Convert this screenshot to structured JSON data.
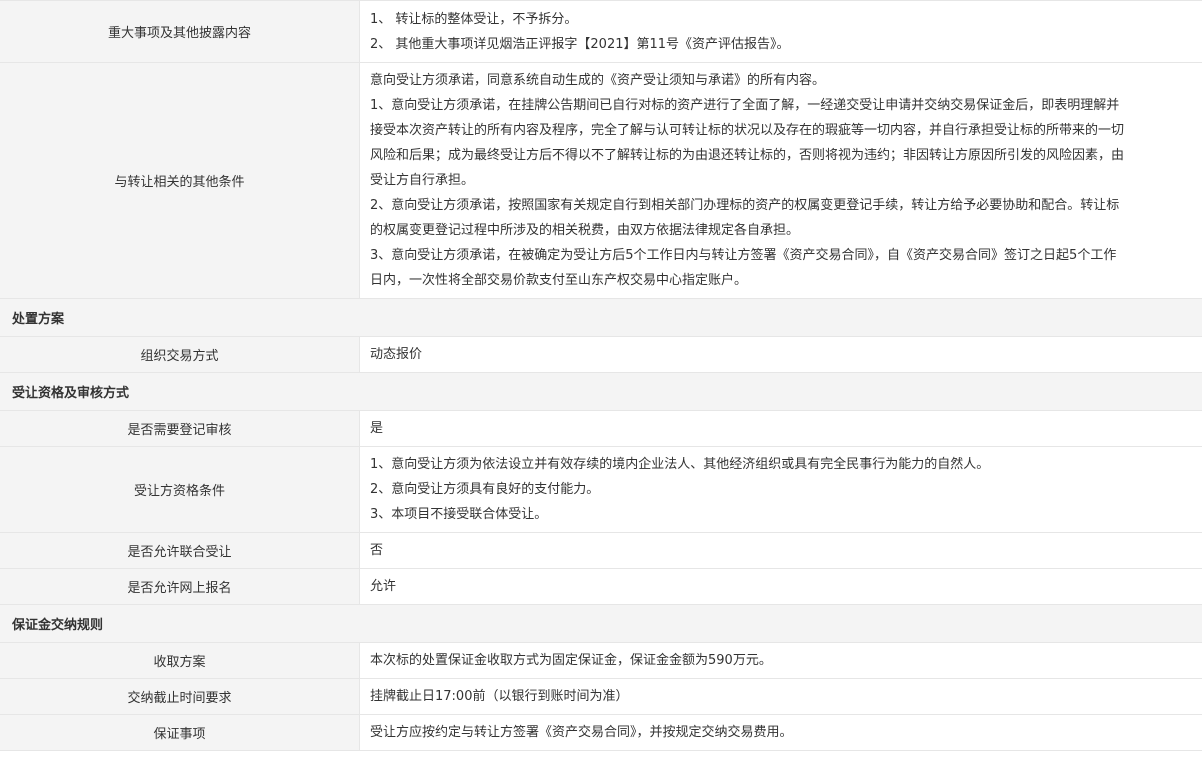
{
  "rows": [
    {
      "type": "field",
      "label": "重大事项及其他披露内容",
      "lines": [
        "1、 转让标的整体受让，不予拆分。",
        "2、 其他重大事项详见烟浩正评报字【2021】第11号《资产评估报告》。"
      ]
    },
    {
      "type": "field",
      "label": "与转让相关的其他条件",
      "lines": [
        "意向受让方须承诺，同意系统自动生成的《资产受让须知与承诺》的所有内容。",
        "1、意向受让方须承诺，在挂牌公告期间已自行对标的资产进行了全面了解，一经递交受让申请并交纳交易保证金后，即表明理解并",
        "接受本次资产转让的所有内容及程序，完全了解与认可转让标的状况以及存在的瑕疵等一切内容，并自行承担受让标的所带来的一切",
        "风险和后果；成为最终受让方后不得以不了解转让标的为由退还转让标的，否则将视为违约；非因转让方原因所引发的风险因素，由",
        "受让方自行承担。",
        "2、意向受让方须承诺，按照国家有关规定自行到相关部门办理标的资产的权属变更登记手续，转让方给予必要协助和配合。转让标",
        "的权属变更登记过程中所涉及的相关税费，由双方依据法律规定各自承担。",
        "3、意向受让方须承诺，在被确定为受让方后5个工作日内与转让方签署《资产交易合同》，自《资产交易合同》签订之日起5个工作",
        "日内，一次性将全部交易价款支付至山东产权交易中心指定账户。"
      ]
    },
    {
      "type": "section",
      "label": "处置方案"
    },
    {
      "type": "field",
      "label": "组织交易方式",
      "lines": [
        "动态报价"
      ]
    },
    {
      "type": "section",
      "label": "受让资格及审核方式"
    },
    {
      "type": "field",
      "label": "是否需要登记审核",
      "lines": [
        "是"
      ]
    },
    {
      "type": "field",
      "label": "受让方资格条件",
      "lines": [
        "1、意向受让方须为依法设立并有效存续的境内企业法人、其他经济组织或具有完全民事行为能力的自然人。",
        "2、意向受让方须具有良好的支付能力。",
        "3、本项目不接受联合体受让。"
      ]
    },
    {
      "type": "field",
      "label": "是否允许联合受让",
      "lines": [
        "否"
      ]
    },
    {
      "type": "field",
      "label": "是否允许网上报名",
      "lines": [
        "允许"
      ]
    },
    {
      "type": "section",
      "label": "保证金交纳规则"
    },
    {
      "type": "field",
      "label": "收取方案",
      "lines": [
        "本次标的处置保证金收取方式为固定保证金，保证金金额为590万元。"
      ]
    },
    {
      "type": "field",
      "label": "交纳截止时间要求",
      "lines": [
        "挂牌截止日17:00前（以银行到账时间为准）"
      ]
    },
    {
      "type": "field",
      "label": "保证事项",
      "lines": [
        "受让方应按约定与转让方签署《资产交易合同》，并按规定交纳交易费用。"
      ]
    }
  ]
}
